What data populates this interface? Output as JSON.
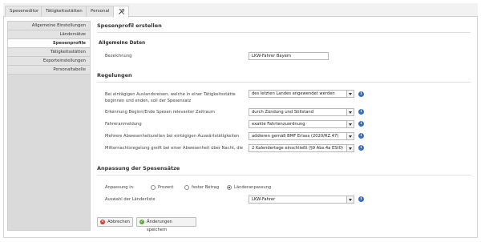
{
  "tabs": [
    {
      "label": "Speseneditor"
    },
    {
      "label": "Tätigkeitsstätten"
    },
    {
      "label": "Personal"
    },
    {
      "label": ""
    }
  ],
  "sidebar": {
    "items": [
      {
        "label": "Allgemeine Einstellungen"
      },
      {
        "label": "Ländersätze"
      },
      {
        "label": "Spesenprofile"
      },
      {
        "label": "Tätigkeitsstätten"
      },
      {
        "label": "Exporteinstellungen"
      },
      {
        "label": "Personaltabelle"
      }
    ]
  },
  "main": {
    "title": "Spesenprofil erstellen",
    "general": {
      "heading": "Allgemeine Daten",
      "name_label": "Bezeichnung",
      "name_value": "LKW-Fahrer Bayern"
    },
    "rules": {
      "heading": "Regelungen",
      "rows": [
        {
          "label": "Bei eintägigen Auslandsreisen, welche in einer Tätigkeitsstätte beginnen und enden, soll der Spesensatz",
          "value": "des letzten Landes angewendet werden"
        },
        {
          "label": "Erkennung Beginn/Ende Spesen relevanter Zeitraum",
          "value": "durch Zündung und Stillstand"
        },
        {
          "label": "Fahreranmeldung",
          "value": "exakte Fahrtenzuordnung"
        },
        {
          "label": "Mehrere Abwesenheitszeiten bei eintägigen Auswärtstätigkeiten",
          "value": "addieren gemäß BMF Erlass (2020/RZ.47)"
        },
        {
          "label": "Mitternachtsregelung greift bei einer Abwesenheit über Nacht, die",
          "value": "2 Kalendertage einschließt (§9 Abs.4a ESt0)"
        }
      ]
    },
    "adjust": {
      "heading": "Anpassung der Spesensätze",
      "adjust_label": "Anpassung in:",
      "radio_options": [
        {
          "label": "Prozent",
          "checked": false
        },
        {
          "label": "fester Betrag",
          "checked": false
        },
        {
          "label": "Länderanpassung",
          "checked": true
        }
      ],
      "country_list_label": "Auswahl der Länderliste",
      "country_list_value": "LKW-Fahrer"
    },
    "buttons": {
      "cancel": "Abbrechen",
      "save": "Änderungen speichern"
    },
    "colors": {
      "accent_blue": "#2f6ed3",
      "cancel_red": "#d9342b",
      "save_green": "#5aa832",
      "sidebar_bg": "#dadada"
    },
    "icons": {
      "info": "info-icon",
      "tools_tab": "wrench-screwdriver-icon",
      "cancel": "close-icon",
      "save": "check-icon"
    }
  }
}
